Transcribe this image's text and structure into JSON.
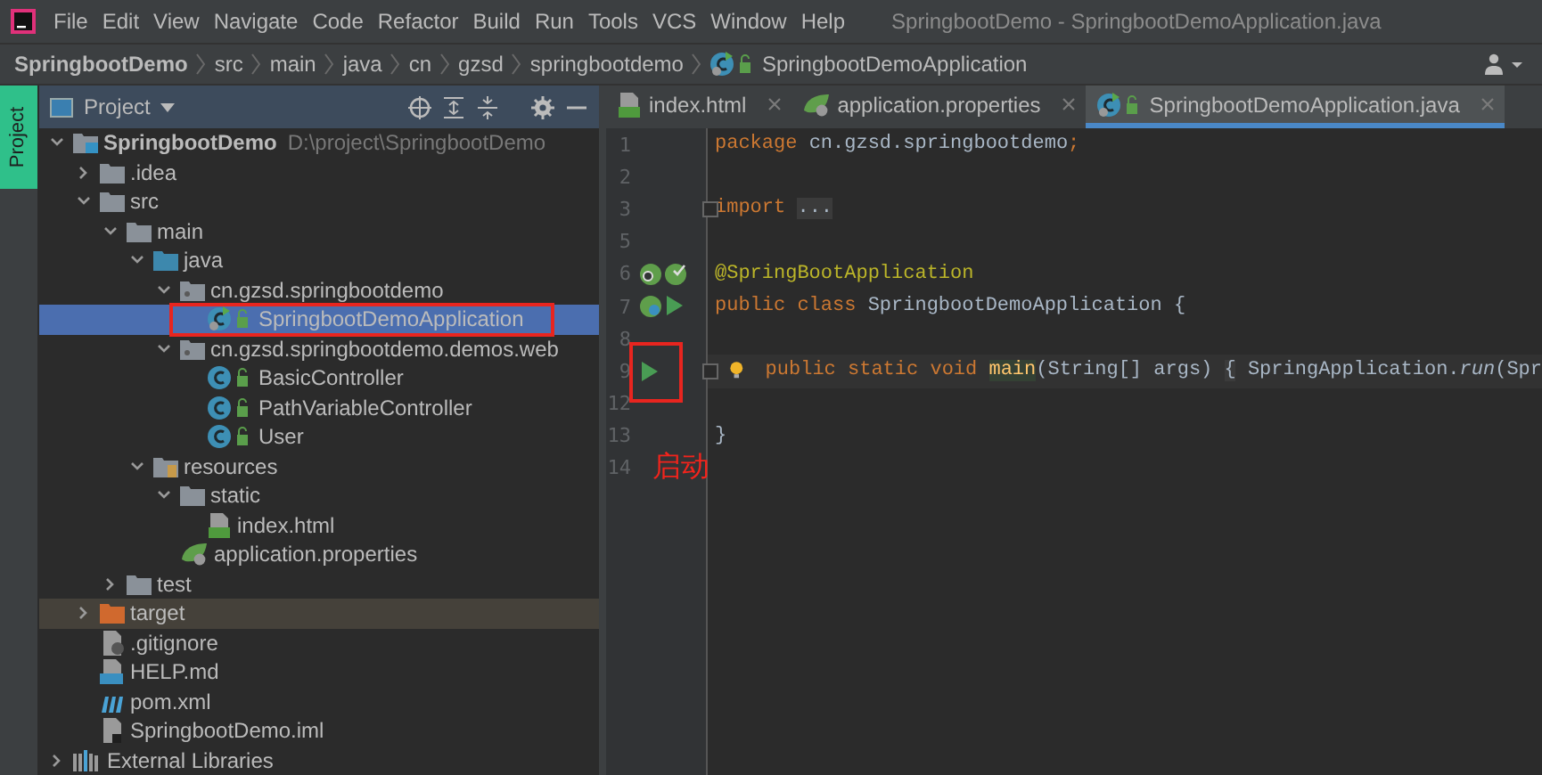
{
  "menu_bar": {
    "items": [
      "File",
      "Edit",
      "View",
      "Navigate",
      "Code",
      "Refactor",
      "Build",
      "Run",
      "Tools",
      "VCS",
      "Window",
      "Help"
    ],
    "title": "SpringbootDemo - SpringbootDemoApplication.java"
  },
  "breadcrumb": [
    "SpringbootDemo",
    "src",
    "main",
    "java",
    "cn",
    "gzsd",
    "springbootdemo",
    "SpringbootDemoApplication"
  ],
  "tool_strip": {
    "tab": {
      "label": "Project",
      "selected": true
    }
  },
  "project_panel": {
    "title": "Project",
    "tree": [
      {
        "label": "SpringbootDemo",
        "hint": "D:\\project\\SpringbootDemo",
        "kind": "module",
        "expanded": true,
        "children": [
          {
            "label": ".idea",
            "kind": "folder",
            "expanded": false
          },
          {
            "label": "src",
            "kind": "folder",
            "expanded": true,
            "children": [
              {
                "label": "main",
                "kind": "folder",
                "expanded": true,
                "children": [
                  {
                    "label": "java",
                    "kind": "source",
                    "expanded": true,
                    "children": [
                      {
                        "label": "cn.gzsd.springbootdemo",
                        "kind": "package",
                        "expanded": true,
                        "children": [
                          {
                            "label": "SpringbootDemoApplication",
                            "kind": "app",
                            "selected": true,
                            "outlined": true
                          }
                        ]
                      },
                      {
                        "label": "cn.gzsd.springbootdemo.demos.web",
                        "kind": "package",
                        "expanded": true,
                        "children": [
                          {
                            "label": "BasicController",
                            "kind": "class",
                            "selected": false
                          },
                          {
                            "label": "PathVariableController",
                            "kind": "class",
                            "selected": false
                          },
                          {
                            "label": "User",
                            "kind": "class",
                            "selected": false
                          }
                        ]
                      }
                    ]
                  },
                  {
                    "label": "resources",
                    "kind": "resources",
                    "expanded": true,
                    "children": [
                      {
                        "label": "static",
                        "kind": "folder",
                        "expanded": true,
                        "children": [
                          {
                            "label": "index.html",
                            "kind": "html"
                          }
                        ]
                      },
                      {
                        "label": "application.properties",
                        "kind": "properties"
                      }
                    ]
                  }
                ]
              },
              {
                "label": "test",
                "kind": "folder",
                "expanded": false
              }
            ]
          },
          {
            "label": "target",
            "kind": "excluded",
            "expanded": false
          },
          {
            "label": ".gitignore",
            "kind": "ignore"
          },
          {
            "label": "HELP.md",
            "kind": "markdown"
          },
          {
            "label": "pom.xml",
            "kind": "maven"
          },
          {
            "label": "SpringbootDemo.iml",
            "kind": "file"
          }
        ]
      },
      {
        "label": "External Libraries",
        "kind": "library",
        "expanded": false
      }
    ]
  },
  "editor_tabs": [
    {
      "label": "index.html",
      "kind": "html",
      "selected": false
    },
    {
      "label": "application.properties",
      "kind": "properties",
      "selected": false
    },
    {
      "label": "SpringbootDemoApplication.java",
      "kind": "app",
      "selected": true
    }
  ],
  "code_lines": [
    {
      "number": "1",
      "tokens": [
        {
          "text": "package",
          "kind": "keyword"
        },
        {
          "text": " cn.gzsd.springbootdemo",
          "kind": "plain"
        },
        {
          "text": ";",
          "kind": "keyword"
        }
      ]
    },
    {
      "number": "2"
    },
    {
      "number": "3",
      "fold": true,
      "tokens": [
        {
          "text": "import ",
          "kind": "keyword"
        },
        {
          "text": "...",
          "kind": "folded"
        }
      ]
    },
    {
      "number": "5"
    },
    {
      "number": "6",
      "gutter": [
        {
          "kind": "spring-search"
        },
        {
          "kind": "spring-check"
        }
      ],
      "tokens": [
        {
          "text": "@SpringBootApplication",
          "kind": "annotation"
        }
      ]
    },
    {
      "number": "7",
      "gutter": [
        {
          "kind": "spring-bean"
        },
        {
          "kind": "run"
        }
      ],
      "tokens": [
        {
          "text": "public class",
          "kind": "keyword"
        },
        {
          "text": " SpringbootDemoApplication {",
          "kind": "plain"
        }
      ]
    },
    {
      "number": "8"
    },
    {
      "number": "9",
      "current": true,
      "fold": true,
      "bulb": true,
      "gutter": [
        {
          "kind": "run"
        }
      ],
      "outlined": true,
      "tokens": [
        {
          "text": "public static void ",
          "kind": "keyword"
        },
        {
          "text": "main",
          "kind": "method"
        },
        {
          "text": "(String[] args) ",
          "kind": "plain"
        },
        {
          "text": "{",
          "kind": "folded"
        },
        {
          "text": " SpringApplication.",
          "kind": "plain"
        },
        {
          "text": "run",
          "kind": "static"
        },
        {
          "text": "(Spr",
          "kind": "plain"
        }
      ]
    },
    {
      "number": "12"
    },
    {
      "number": "13",
      "tokens": [
        {
          "text": "}",
          "kind": "plain"
        }
      ]
    },
    {
      "number": "14",
      "note": "启动"
    }
  ]
}
